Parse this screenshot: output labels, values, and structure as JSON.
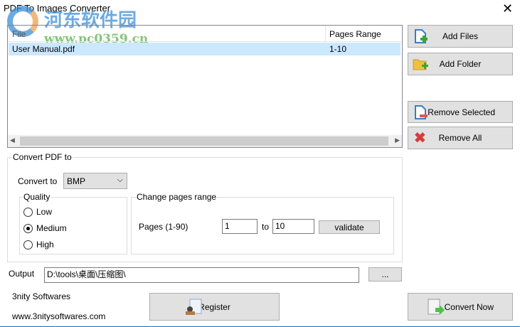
{
  "window": {
    "title": "PDF To Images Converter",
    "close_icon": "close-icon"
  },
  "watermark": {
    "text": "河东软件园",
    "url": "www.pc0359.cn"
  },
  "file_list": {
    "columns": [
      "File",
      "Pages Range"
    ],
    "rows": [
      {
        "file": "User Manual.pdf",
        "range": "1-10",
        "selected": true
      }
    ]
  },
  "side_buttons": {
    "add_files": "Add Files",
    "add_folder": "Add Folder",
    "remove_selected": "Remove Selected",
    "remove_all": "Remove All"
  },
  "convert": {
    "group_label": "Convert PDF to",
    "convert_to_label": "Convert to",
    "format": "BMP",
    "quality": {
      "label": "Quality",
      "options": [
        "Low",
        "Medium",
        "High"
      ],
      "selected": "Medium"
    },
    "pages": {
      "label": "Change pages range",
      "pages_label": "Pages (1-90)",
      "from": "1",
      "to_label": "to",
      "to": "10",
      "validate": "validate"
    }
  },
  "output": {
    "label": "Output",
    "path": "D:\\tools\\桌面\\压缩图\\",
    "browse": "..."
  },
  "footer": {
    "company": "3nity Softwares",
    "website": "www.3nitysoftwares.com",
    "register": "Register",
    "convert_now": "Convert Now"
  }
}
